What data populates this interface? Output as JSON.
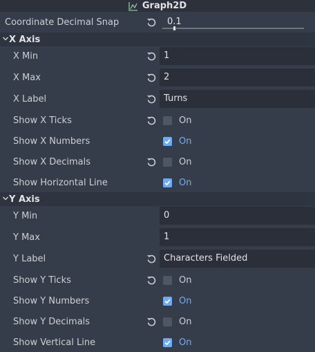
{
  "header": {
    "title": "Graph2D",
    "icon": "graph-icon"
  },
  "snap": {
    "label": "Coordinate Decimal Snap",
    "value": "0.1",
    "slider_fraction": 0.1
  },
  "x_axis": {
    "title": "X Axis",
    "x_min": {
      "label": "X Min",
      "value": "1"
    },
    "x_max": {
      "label": "X Max",
      "value": "2"
    },
    "x_label": {
      "label": "X Label",
      "value": "Turns"
    },
    "show_ticks": {
      "label": "Show X Ticks",
      "state": "On",
      "checked": false
    },
    "show_numbers": {
      "label": "Show X Numbers",
      "state": "On",
      "checked": true
    },
    "show_decimals": {
      "label": "Show X Decimals",
      "state": "On",
      "checked": false
    },
    "show_line": {
      "label": "Show Horizontal Line",
      "state": "On",
      "checked": true
    }
  },
  "y_axis": {
    "title": "Y Axis",
    "y_min": {
      "label": "Y Min",
      "value": "0"
    },
    "y_max": {
      "label": "Y Max",
      "value": "1"
    },
    "y_label": {
      "label": "Y Label",
      "value": "Characters Fielded"
    },
    "show_ticks": {
      "label": "Show Y Ticks",
      "state": "On",
      "checked": false
    },
    "show_numbers": {
      "label": "Show Y Numbers",
      "state": "On",
      "checked": true
    },
    "show_decimals": {
      "label": "Show Y Decimals",
      "state": "On",
      "checked": false
    },
    "show_line": {
      "label": "Show Vertical Line",
      "state": "On",
      "checked": true
    }
  },
  "colors": {
    "accent": "#6eabf0",
    "panel": "#363d4a",
    "field": "#2a2f39"
  }
}
